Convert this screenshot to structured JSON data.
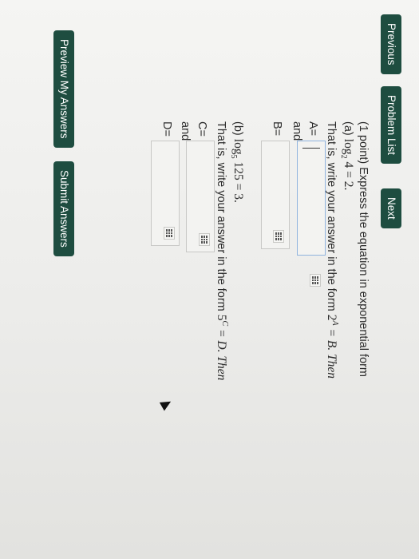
{
  "nav": {
    "previous": "Previous",
    "problem_list": "Problem List",
    "next": "Next"
  },
  "problem": {
    "intro": "(1 point) Express the equation in exponential form",
    "part_a": {
      "label": "(a)",
      "log_word": "log",
      "base": "2",
      "equation_rest": "4 = 2.",
      "instruction_prefix": "That is, write your answer in the form",
      "form_base": "2",
      "form_exp": "A",
      "form_rest": "= B. Then",
      "field1_label": "A=",
      "and_label": "and",
      "field2_label": "B="
    },
    "part_b": {
      "label": "(b)",
      "log_word": "log",
      "base": "5",
      "equation_rest": "125 = 3.",
      "instruction_prefix": "That is, write your answer in the form",
      "form_base": "5",
      "form_exp": "C",
      "form_rest": "= D. Then",
      "field1_label": "C=",
      "and_label": "and",
      "field2_label": "D="
    }
  },
  "actions": {
    "preview": "Preview My Answers",
    "submit": "Submit Answers"
  },
  "icons": {
    "palette": "equation-palette-icon",
    "cursor": "mouse-pointer-icon"
  },
  "colors": {
    "button_bg": "#1e4d40",
    "focus_border": "#8fb3de"
  }
}
